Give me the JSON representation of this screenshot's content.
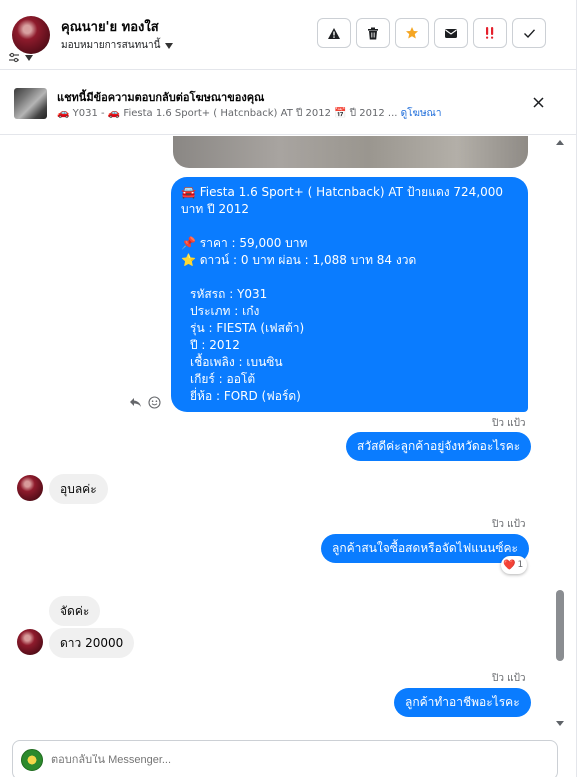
{
  "header": {
    "name": "คุณนาย'ย ทองใส",
    "assign_label": "มอบหมายการสนทนานี้",
    "actions": [
      "warning-icon",
      "trash-icon",
      "star-icon",
      "mail-icon",
      "spam-icon",
      "check-icon"
    ],
    "colors": {
      "star": "#f5a623",
      "spam": "#e4202c"
    }
  },
  "ad": {
    "title": "แชทนี้มีข้อความตอบกลับต่อโฆษณาของคุณ",
    "subtitle": "🚗 Y031 - 🚗 Fiesta 1.6 Sport+ ( Hatcnback) AT ปี 2012 📅 ปี 2012 ...",
    "link": "ดูโฆษณา"
  },
  "messages": {
    "car_details": {
      "line1": "🚘 Fiesta 1.6 Sport+ ( Hatcnback) AT ป้ายแดง 724,000 บาท ปี 2012",
      "line2": "",
      "line3": "📌 ราคา : 59,000 บาท",
      "line4": "⭐ ดาวน์ : 0 บาท ผ่อน : 1,088 บาท 84 งวด",
      "line5": "",
      "line6": "รหัสรถ : Y031",
      "line7": "ประเภท : เก๋ง",
      "line8": "รุ่น : FIESTA (เฟสต้า)",
      "line9": "ปี : 2012",
      "line10": "เชื้อเพลิง : เบนซิน",
      "line11": "เกียร์ : ออโต้",
      "line12": "ยี่ห้อ : FORD (ฟอร์ด)"
    },
    "sender1": "ปิว แป้ว",
    "out1": "สวัสดีค่ะลูกค้าอยู่จังหวัดอะไรคะ",
    "in1": "อุบลค่ะ",
    "sender2": "ปิว แป้ว",
    "out2": "ลูกค้าสนใจซื้อสดหรือจัดไฟแนนซ์คะ",
    "reaction_emoji": "❤️",
    "reaction_count": "1",
    "in2": "จัดค่ะ",
    "in3": "ดาว 20000",
    "sender3": "ปิว แป้ว",
    "out3": "ลูกค้าทำอาชีพอะไรคะ"
  },
  "composer": {
    "placeholder": "ตอบกลับใน Messenger..."
  },
  "colors": {
    "bubble_out": "#0a7cff",
    "bubble_in": "#f0f0f0"
  }
}
